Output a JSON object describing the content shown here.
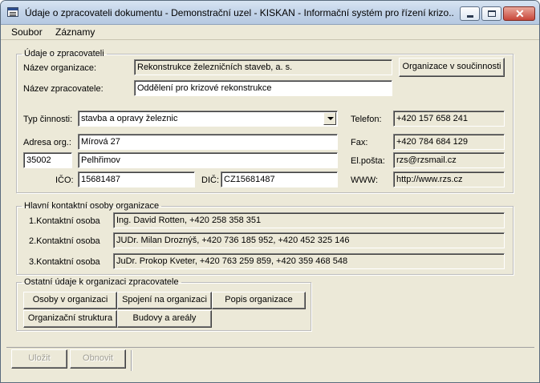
{
  "window": {
    "title": "Údaje o zpracovateli dokumentu - Demonstrační uzel - KISKAN - Informační systém pro řízení krizo...",
    "controls": {
      "minimize": "minimize-icon",
      "maximize": "maximize-icon",
      "close": "close-icon"
    },
    "close_glyph": "✕"
  },
  "menu": [
    "Soubor",
    "Záznamy"
  ],
  "processor": {
    "legend": "Údaje o zpracovateli",
    "org_name_label": "Název organizace:",
    "org_name_value": "Rekonstrukce železničních staveb, a. s.",
    "org_coop_button": "Organizace v součinnosti",
    "processor_name_label": "Název zpracovatele:",
    "processor_name_value": "Oddělení pro krizové rekonstrukce",
    "activity_label": "Typ činnosti:",
    "activity_value": "stavba a opravy železnic",
    "phone_label": "Telefon:",
    "phone_value": "+420 157 658 241",
    "address_label": "Adresa org.:",
    "street_value": "Mírová 27",
    "fax_label": "Fax:",
    "fax_value": "+420 784 684 129",
    "zip_value": "35002",
    "city_value": "Pelhřimov",
    "email_label": "El.pošta:",
    "email_value": "rzs@rzsmail.cz",
    "ico_label": "IČO:",
    "ico_value": "15681487",
    "dic_label": "DIČ:",
    "dic_value": "CZ15681487",
    "www_label": "WWW:",
    "www_value": "http://www.rzs.cz"
  },
  "contacts": {
    "legend": "Hlavní kontaktní osoby organizace",
    "items": [
      {
        "label": "1.Kontaktní osoba",
        "value": "Ing. David Rotten, +420 258 358 351"
      },
      {
        "label": "2.Kontaktní osoba",
        "value": "JUDr. Milan Droznýš, +420 736 185 952, +420 452 325 146"
      },
      {
        "label": "3.Kontaktní osoba",
        "value": "JuDr. Prokop Kveter, +420 763 259 859, +420 359 468 548"
      }
    ]
  },
  "other": {
    "legend": "Ostatní údaje k organizaci zpracovatele",
    "buttons": [
      "Osoby v organizaci",
      "Spojení na organizaci",
      "Popis organizace",
      "Organizační struktura",
      "Budovy a areály"
    ]
  },
  "footer": {
    "save": "Uložit",
    "renew": "Obnovit"
  },
  "colors": {
    "window_bg": "#ece9d8",
    "title_gradient": "#c2d3e8",
    "close_button": "#c8473a"
  }
}
